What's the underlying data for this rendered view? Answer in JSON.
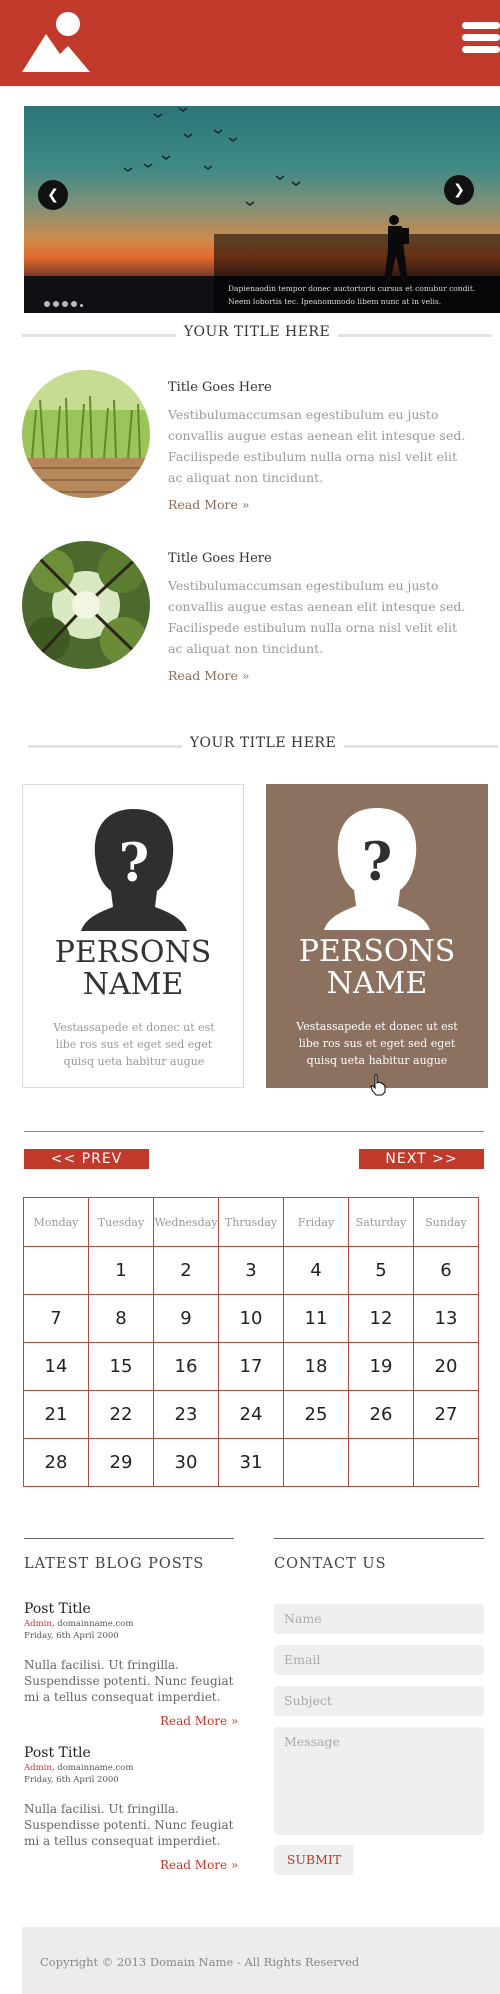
{
  "brand": {
    "accent": "#c0392b",
    "card_accent": "#8c7160"
  },
  "header": {
    "logo_icon": "mountain-sun-icon",
    "menu_icon": "hamburger-menu-icon"
  },
  "slider": {
    "caption": "Dapienaodin tempor donec auctortoris cursus et conubur condit. Neem lobortis tec. Ipeanommodo libem nunc at in velis.",
    "prev_icon": "chevron-left-icon",
    "next_icon": "chevron-right-icon",
    "dots": 5
  },
  "section1": {
    "title": "YOUR TITLE HERE"
  },
  "articles": [
    {
      "title": "Title Goes Here",
      "body": "Vestibulumaccumsan egestibulum eu justo convallis augue estas aenean elit intesque sed. Facilispede estibulum nulla orna nisl velit elit ac aliquat non tincidunt.",
      "read_more": "Read More »"
    },
    {
      "title": "Title Goes Here",
      "body": "Vestibulumaccumsan egestibulum eu justo convallis augue estas aenean elit intesque sed. Facilispede estibulum nulla orna nisl velit elit ac aliquat non tincidunt.",
      "read_more": "Read More »"
    }
  ],
  "section2": {
    "title": "YOUR TITLE HERE"
  },
  "persons": [
    {
      "name": "PERSONS NAME",
      "desc": "Vestassapede et donec ut est libe ros sus et eget sed eget quisq ueta habitur augue"
    },
    {
      "name": "PERSONS NAME",
      "desc": "Vestassapede et donec ut est libe ros sus et eget sed eget quisq ueta habitur augue"
    }
  ],
  "calendar": {
    "prev_label": "<< PREV",
    "next_label": "NEXT >>",
    "days": [
      "Monday",
      "Tuesday",
      "Wednesday",
      "Thrusday",
      "Friday",
      "Saturday",
      "Sunday"
    ],
    "weeks": [
      [
        "",
        "1",
        "2",
        "3",
        "4",
        "5",
        "6"
      ],
      [
        "7",
        "8",
        "9",
        "10",
        "11",
        "12",
        "13"
      ],
      [
        "14",
        "15",
        "16",
        "17",
        "18",
        "19",
        "20"
      ],
      [
        "21",
        "22",
        "23",
        "24",
        "25",
        "26",
        "27"
      ],
      [
        "28",
        "29",
        "30",
        "31",
        "",
        "",
        ""
      ]
    ]
  },
  "blog": {
    "heading": "LATEST BLOG POSTS",
    "posts": [
      {
        "title": "Post Title",
        "author": "Admin",
        "domain": ", domainname.com",
        "date": "Friday, 6th April 2000",
        "body": "Nulla facilisi. Ut fringilla. Suspendisse potenti. Nunc feugiat mi a tellus consequat imperdiet.",
        "read_more": "Read More »"
      },
      {
        "title": "Post Title",
        "author": "Admin",
        "domain": ", domainname.com",
        "date": "Friday, 6th April 2000",
        "body": "Nulla facilisi. Ut fringilla. Suspendisse potenti. Nunc feugiat mi a tellus consequat imperdiet.",
        "read_more": "Read More »"
      }
    ]
  },
  "contact": {
    "heading": "CONTACT US",
    "name_placeholder": "Name",
    "email_placeholder": "Email",
    "subject_placeholder": "Subject",
    "message_placeholder": "Message",
    "submit_label": "SUBMIT"
  },
  "footer": {
    "copyright": "Copyright © 2013 Domain Name - All Rights Reserved"
  }
}
